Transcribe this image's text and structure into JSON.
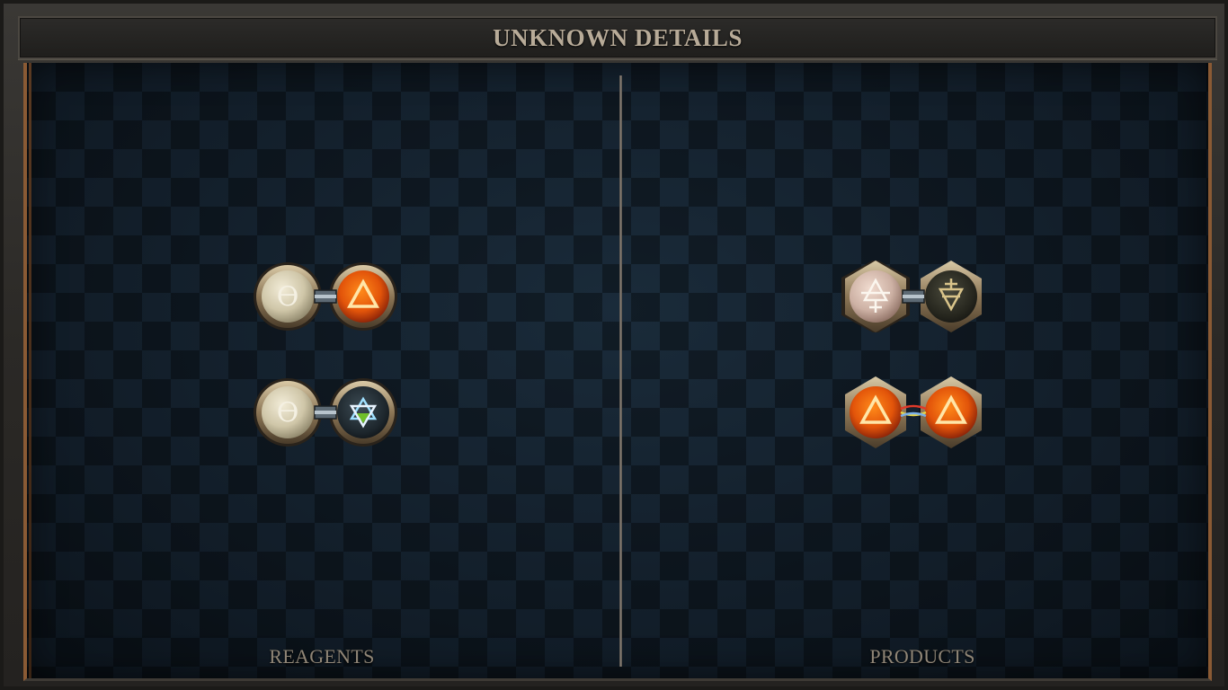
{
  "title": "UNKNOWN DETAILS",
  "reagents": {
    "label": "REAGENTS",
    "items": [
      {
        "left": {
          "icon": "salt-symbol-icon",
          "glyph": "ϴ",
          "color": "pale"
        },
        "right": {
          "icon": "fire-symbol-icon",
          "glyph": "△",
          "color": "fire"
        },
        "bond": "single"
      },
      {
        "left": {
          "icon": "salt-symbol-icon",
          "glyph": "ϴ",
          "color": "pale"
        },
        "right": {
          "icon": "quintessence-symbol-icon",
          "glyph": "✡",
          "color": "dark-prism"
        },
        "bond": "single"
      }
    ]
  },
  "products": {
    "label": "PRODUCTS",
    "items": [
      {
        "left": {
          "icon": "air-with-cross-symbol-icon",
          "color": "pale-pink"
        },
        "right": {
          "icon": "earth-with-cross-symbol-icon",
          "color": "dark-olive"
        },
        "bond": "single"
      },
      {
        "left": {
          "icon": "fire-symbol-icon",
          "glyph": "△",
          "color": "fire"
        },
        "right": {
          "icon": "fire-symbol-icon",
          "glyph": "△",
          "color": "fire"
        },
        "bond": "triplex"
      }
    ]
  },
  "colors": {
    "title": "#b8ab98",
    "label": "#8f8576",
    "panel": "#13202c",
    "accent_border": "#8a5a34"
  }
}
